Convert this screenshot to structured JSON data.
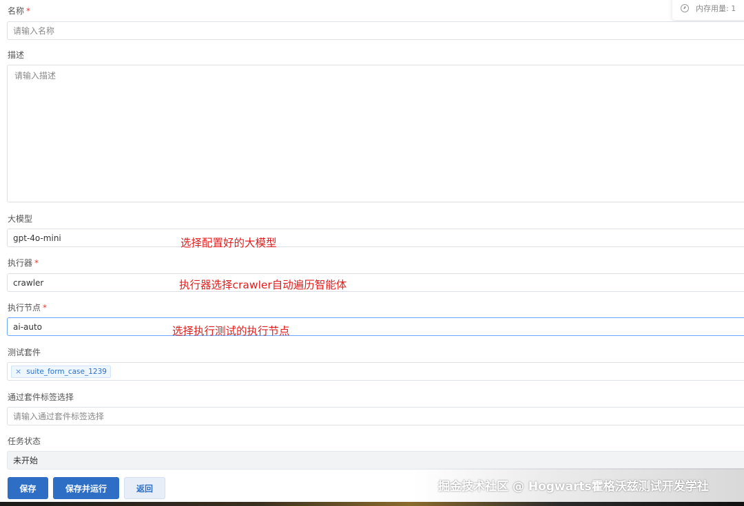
{
  "memory": {
    "label": "内存用量: 1",
    "icon": "gauge-icon"
  },
  "form": {
    "name": {
      "label": "名称",
      "required": "*",
      "placeholder": "请输入名称"
    },
    "description": {
      "label": "描述",
      "placeholder": "请输入描述"
    },
    "model": {
      "label": "大模型",
      "value": "gpt-4o-mini"
    },
    "executor": {
      "label": "执行器",
      "required": "*",
      "value": "crawler"
    },
    "node": {
      "label": "执行节点",
      "required": "*",
      "value": "ai-auto"
    },
    "suite": {
      "label": "测试套件",
      "tag": "suite_form_case_1239",
      "tag_close": "×"
    },
    "suite_tag": {
      "label": "通过套件标签选择",
      "placeholder": "请输入通过套件标签选择"
    },
    "status": {
      "label": "任务状态",
      "value": "未开始"
    }
  },
  "annotations": {
    "model": "选择配置好的大模型",
    "executor": "执行器选择crawler自动遍历智能体",
    "node": "选择执行测试的执行节点"
  },
  "buttons": {
    "save": "保存",
    "save_run": "保存并运行",
    "back": "返回"
  },
  "watermark": "掘金技术社区 @ Hogwarts霍格沃兹测试开发学社",
  "colors": {
    "primary": "#2e6ec5",
    "annotation": "#e11d1d",
    "required": "#e53935"
  }
}
